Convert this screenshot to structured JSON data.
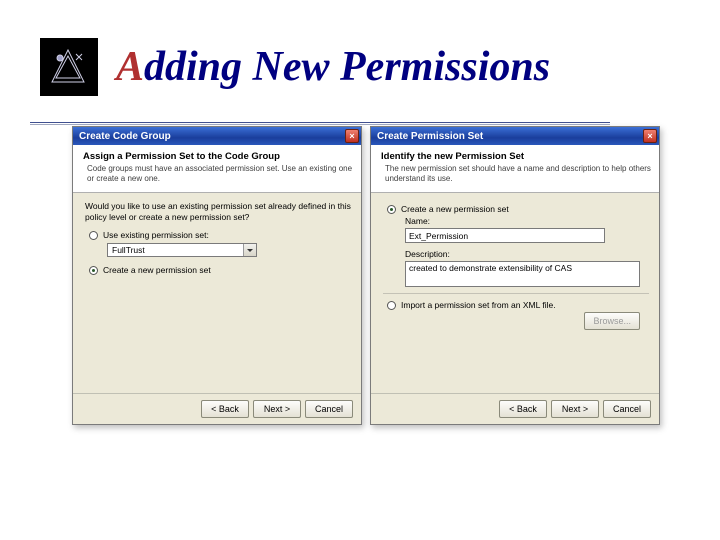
{
  "slide": {
    "title_pre": "A",
    "title_rest": "dding New Permissions"
  },
  "dialog_left": {
    "titlebar": "Create Code Group",
    "close": "×",
    "head_title": "Assign a Permission Set to the Code Group",
    "head_sub": "Code groups must have an associated permission set. Use an existing one or create a new one.",
    "prompt": "Would you like to use an existing permission set already defined in this policy level or create a new permission set?",
    "opt_existing": "Use existing permission set:",
    "combo_value": "FullTrust",
    "opt_new": "Create a new permission set",
    "btn_back": "< Back",
    "btn_next": "Next >",
    "btn_cancel": "Cancel"
  },
  "dialog_right": {
    "titlebar": "Create Permission Set",
    "close": "×",
    "head_title": "Identify the new Permission Set",
    "head_sub": "The new permission set should have a name and description to help others understand its use.",
    "opt_create": "Create a new permission set",
    "label_name": "Name:",
    "name_value": "Ext_Permission",
    "label_desc": "Description:",
    "desc_value": "created to demonstrate extensibility of CAS",
    "opt_import": "Import a permission set from an XML file.",
    "btn_browse": "Browse...",
    "btn_back": "< Back",
    "btn_next": "Next >",
    "btn_cancel": "Cancel"
  }
}
